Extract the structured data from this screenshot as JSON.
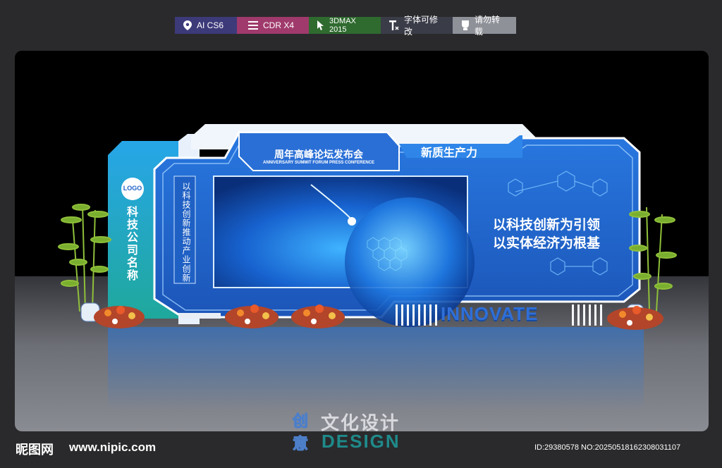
{
  "tags": [
    {
      "label": "AI CS6",
      "icon": "map-pin-icon",
      "color": "#3d3a7a"
    },
    {
      "label": "CDR X4",
      "icon": "layers-icon",
      "color": "#a03a6c"
    },
    {
      "label": "3DMAX 2015",
      "icon": "cursor-icon",
      "color": "#2f6a2f"
    },
    {
      "label": "字体可修改",
      "icon": "text-edit-icon",
      "color": "#3a3c48"
    },
    {
      "label": "请勿转载",
      "icon": "badge-icon",
      "color": "#8f9199"
    }
  ],
  "backdrop": {
    "logo": "LOGO",
    "company": "科技公司名称",
    "vertical_slogan": "以科技创新推动产业创新",
    "forum_title": "周年高峰论坛发布会",
    "forum_subtitle": "ANNIVERSARY SUMMIT FORUM PRESS CONFERENCE",
    "right_banner": "新质生产力",
    "slogan_line1": "以科技创新为引领",
    "slogan_line2": "以实体经济为根基",
    "innovate": "INNOVATE"
  },
  "watermark": {
    "cn": "文化设计",
    "en": "DESIGN",
    "glyph_top": "创",
    "glyph_bottom": "意"
  },
  "footer": {
    "site_cn": "昵图网",
    "site_url": "www.nipic.com",
    "id_text": "ID:29380578 NO:20250518162308031107"
  },
  "colors": {
    "board_blue": "#1f63c9",
    "board_light": "#2f86e8",
    "teal": "#1fa89c",
    "white": "#ffffff"
  }
}
